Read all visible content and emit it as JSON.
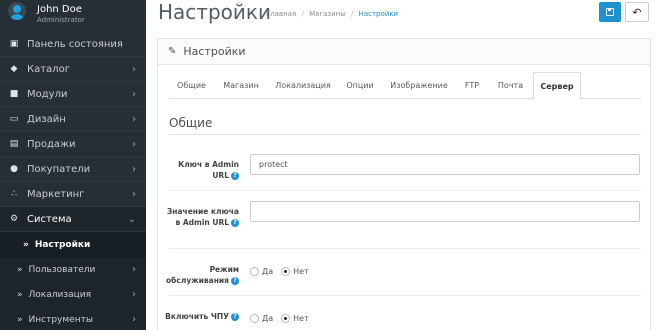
{
  "user": {
    "name": "John Doe",
    "role": "Administrator"
  },
  "sidebar": {
    "items": [
      {
        "label": "Панель состояния",
        "icon": "dashboard-icon",
        "glyph": "▣",
        "chevron": ""
      },
      {
        "label": "Каталог",
        "icon": "tag-icon",
        "glyph": "◆",
        "chevron": "›"
      },
      {
        "label": "Модули",
        "icon": "puzzle-icon",
        "glyph": "■",
        "chevron": "›"
      },
      {
        "label": "Дизайн",
        "icon": "monitor-icon",
        "glyph": "▭",
        "chevron": "›"
      },
      {
        "label": "Продажи",
        "icon": "cart-icon",
        "glyph": "▤",
        "chevron": "›"
      },
      {
        "label": "Покупатели",
        "icon": "user-icon",
        "glyph": "●",
        "chevron": "›"
      },
      {
        "label": "Маркетинг",
        "icon": "share-icon",
        "glyph": "∴",
        "chevron": "›"
      },
      {
        "label": "Система",
        "icon": "gear-icon",
        "glyph": "⚙",
        "chevron": "⌄"
      }
    ],
    "sub_items": [
      {
        "label": "Настройки",
        "arrow": "»",
        "chevron": ""
      },
      {
        "label": "Пользователи",
        "arrow": "»",
        "chevron": "›"
      },
      {
        "label": "Локализация",
        "arrow": "»",
        "chevron": "›"
      },
      {
        "label": "Инструменты",
        "arrow": "»",
        "chevron": "›"
      }
    ]
  },
  "header": {
    "title": "Настройки",
    "breadcrumb": [
      "Главная",
      "Магазины",
      "Настройки"
    ],
    "breadcrumb_sep": "/",
    "back_glyph": "↶"
  },
  "panel": {
    "title": "Настройки",
    "pencil_glyph": "✎",
    "tabs": [
      "Общие",
      "Магазин",
      "Локализация",
      "Опции",
      "Изображение",
      "FTP",
      "Почта",
      "Сервер"
    ],
    "active_tab": "Сервер",
    "section_title": "Общие",
    "fields": {
      "admin_key": {
        "label": "Ключ в Admin URL",
        "value": "protect"
      },
      "admin_key_value": {
        "label": "Значение ключа в Admin URL",
        "value": ""
      },
      "maintenance": {
        "label": "Режим обслуживания",
        "options": [
          "Да",
          "Нет"
        ],
        "selected": "Нет"
      },
      "seo_url": {
        "label": "Включить ЧПУ",
        "options": [
          "Да",
          "Нет"
        ],
        "selected": "Нет"
      }
    },
    "help_glyph": "?"
  },
  "colors": {
    "sidebar_bg": "#262f36",
    "accent": "#1e91cf"
  }
}
